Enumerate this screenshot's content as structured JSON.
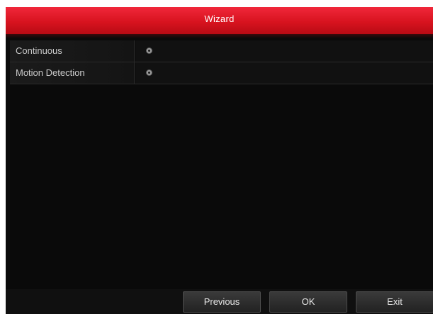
{
  "window": {
    "title": "Wizard"
  },
  "settings": {
    "rows": [
      {
        "label": "Continuous",
        "icon": "gear-icon"
      },
      {
        "label": "Motion Detection",
        "icon": "gear-icon"
      }
    ]
  },
  "footer": {
    "previous_label": "Previous",
    "ok_label": "OK",
    "exit_label": "Exit"
  },
  "colors": {
    "titlebar": "#d8131f",
    "background": "#0a0a0a",
    "text": "#c9c9c9"
  }
}
